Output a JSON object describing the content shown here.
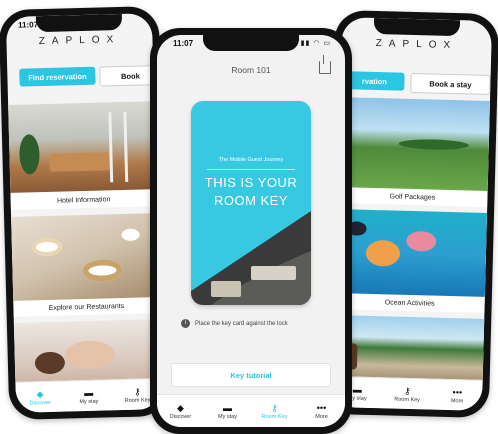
{
  "left_phone": {
    "time": "11:07",
    "brand": "ZAPLOX",
    "find_reservation": "Find reservation",
    "book_a_stay": "Book",
    "cards": [
      "Hotel Information",
      "Explore our Restaurants",
      ""
    ],
    "tabs": [
      {
        "label": "Discover",
        "icon": "tag-icon"
      },
      {
        "label": "My stay",
        "icon": "bed-icon"
      },
      {
        "label": "Room Key",
        "icon": "key-icon"
      }
    ]
  },
  "center_phone": {
    "time": "11:07",
    "title": "Room 101",
    "key_card": {
      "subtitle": "The Mobile Guest Journey",
      "headline_line1": "THIS IS YOUR",
      "headline_line2": "ROOM KEY"
    },
    "hint": "Place the key card against the lock",
    "tutorial_button": "Key tutorial",
    "tabs": [
      {
        "label": "Discover",
        "icon": "tag-icon"
      },
      {
        "label": "My stay",
        "icon": "bed-icon"
      },
      {
        "label": "Room Key",
        "icon": "key-icon"
      },
      {
        "label": "More",
        "icon": "more-icon"
      }
    ]
  },
  "right_phone": {
    "brand": "ZAPLOX",
    "find_reservation": "rvation",
    "book_a_stay": "Book a stay",
    "cards": [
      "Golf Packages",
      "Ocean Activities",
      ""
    ],
    "tabs": [
      {
        "label": "My stay",
        "icon": "bed-icon"
      },
      {
        "label": "Room Key",
        "icon": "key-icon"
      },
      {
        "label": "More",
        "icon": "more-icon"
      }
    ]
  },
  "colors": {
    "accent": "#2bc6e2",
    "phone_frame": "#111111"
  }
}
